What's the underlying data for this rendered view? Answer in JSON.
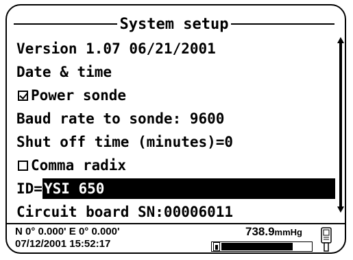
{
  "screen": {
    "title": "System setup",
    "items": [
      {
        "type": "text",
        "label": "Version 1.07 06/21/2001"
      },
      {
        "type": "text",
        "label": "Date & time"
      },
      {
        "type": "checkbox",
        "label": "Power sonde",
        "checked": true
      },
      {
        "type": "text",
        "label": "Baud rate to sonde: 9600"
      },
      {
        "type": "text",
        "label": "Shut off time (minutes)=0"
      },
      {
        "type": "checkbox",
        "label": "Comma radix",
        "checked": false
      },
      {
        "type": "field",
        "label": "ID=",
        "value": "YSI 650"
      },
      {
        "type": "text",
        "label": "Circuit board SN:00006011"
      }
    ]
  },
  "status": {
    "gps": "N 0° 0.000' E 0° 0.000'",
    "datetime": "07/12/2001 15:52:17",
    "pressure_value": "738.9",
    "pressure_unit": "mmHg",
    "battery_level": 0.8,
    "battery_icon": "battery-icon",
    "device_icon": "handheld-device-icon"
  }
}
